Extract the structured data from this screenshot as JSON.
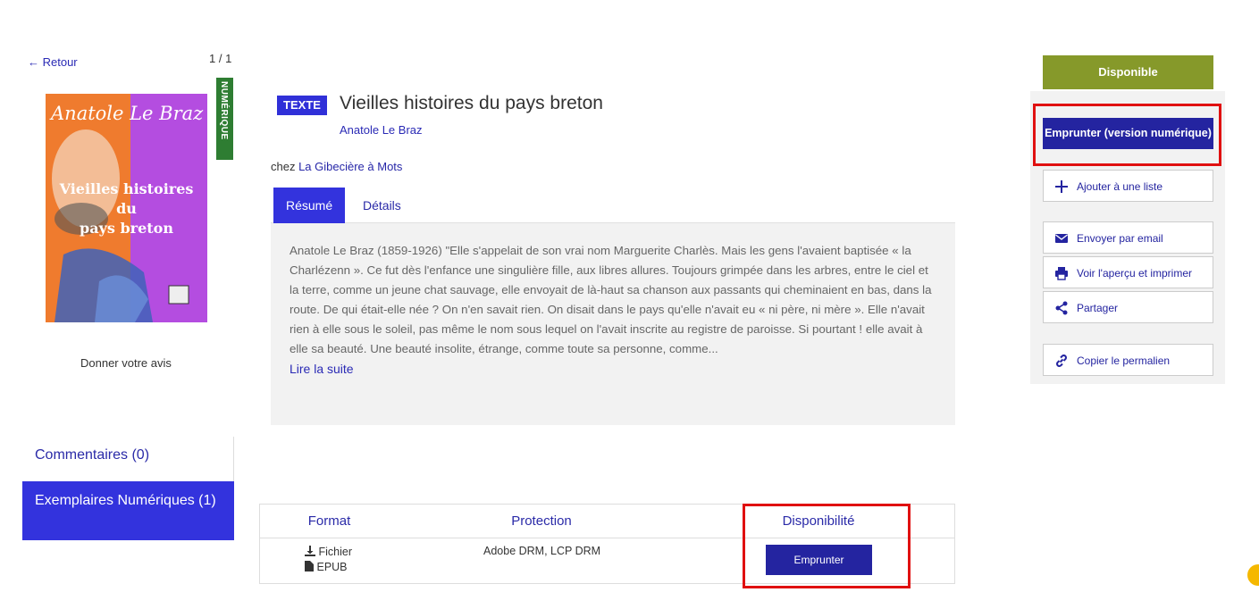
{
  "nav": {
    "back_label": "← Retour",
    "counter": "1 / 1"
  },
  "cover": {
    "author_text": "Anatole Le Braz",
    "title_line1": "Vieilles histoires",
    "title_line2": "du",
    "title_line3": "pays breton",
    "ribbon_label": "NUMÉRIQUE"
  },
  "review_link": "Donner votre avis",
  "side_tabs": [
    {
      "label": "Commentaires (0)"
    },
    {
      "label": "Exemplaires Numériques (1)"
    }
  ],
  "record": {
    "type_badge": "TEXTE",
    "title": "Vieilles histoires du pays breton",
    "author": "Anatole Le Braz",
    "publisher_prefix": "chez ",
    "publisher": "La Gibecière à Mots"
  },
  "tabs": [
    {
      "label": "Résumé"
    },
    {
      "label": "Détails"
    }
  ],
  "summary": {
    "text": "Anatole Le Braz (1859-1926) \"Elle s'appelait de son vrai nom Marguerite Charlès. Mais les gens l'avaient baptisée « la Charlézenn ». Ce fut dès l'enfance une singulière fille, aux libres allures. Toujours grimpée dans les arbres, entre le ciel et la terre, comme un jeune chat sauvage, elle envoyait de là-haut sa chanson aux passants qui cheminaient en bas, dans la route. De qui était-elle née ? On n'en savait rien. On disait dans le pays qu'elle n'avait eu « ni père, ni mère ». Elle n'avait rien à elle sous le soleil, pas même le nom sous lequel on l'avait inscrite au registre de paroisse. Si pourtant ! elle avait à elle sa beauté. Une beauté insolite, étrange, comme toute sa personne, comme...",
    "read_more": "Lire la suite"
  },
  "copies_table": {
    "headers": [
      "Format",
      "Protection",
      "Disponibilité"
    ],
    "rows": [
      {
        "format_line1": "Fichier",
        "format_line2": "EPUB",
        "protection": "Adobe DRM, LCP DRM",
        "action": "Emprunter"
      }
    ]
  },
  "actions": {
    "status": "Disponible",
    "borrow": "Emprunter (version numérique)",
    "add_list": "Ajouter à une liste",
    "email": "Envoyer par email",
    "print": "Voir l'aperçu et imprimer",
    "share": "Partager",
    "permalink": "Copier le permalien"
  },
  "colors": {
    "primary": "#3333dd",
    "dark_primary": "#2424a0",
    "available": "#86992a",
    "highlight": "#e01010",
    "ribbon": "#2e7d32"
  }
}
